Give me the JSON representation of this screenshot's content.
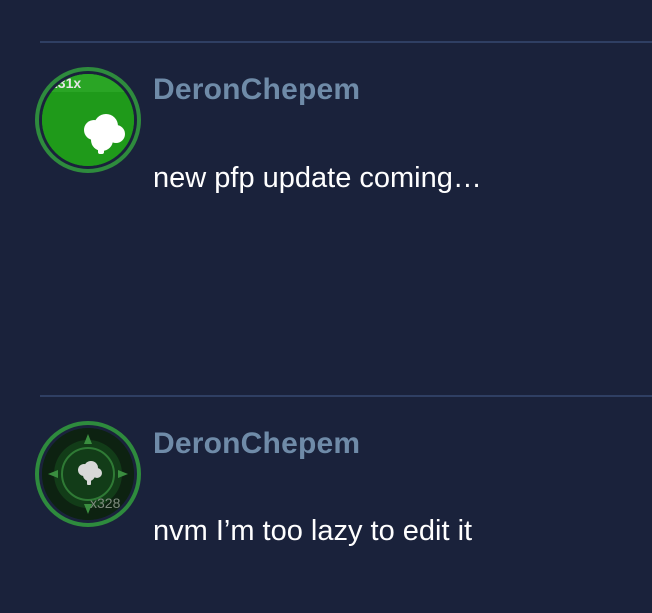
{
  "posts": [
    {
      "username": "DeronChepem",
      "message": "new pfp update coming…",
      "avatar": {
        "badge_text": "231x",
        "icon": "cloud-icon",
        "ring_color": "#2e8b3d",
        "fill_color": "#1f9a1a"
      }
    },
    {
      "username": "DeronChepem",
      "message": "nvm I’m too lazy to edit it",
      "avatar": {
        "badge_text": "x328",
        "icon": "cloud-icon",
        "ring_color": "#2e8b3d",
        "fill_color": "#0f2f14"
      }
    }
  ],
  "colors": {
    "background": "#1a223b",
    "divider": "#2f3f63",
    "username": "#6f8ba8",
    "message": "#ffffff"
  }
}
